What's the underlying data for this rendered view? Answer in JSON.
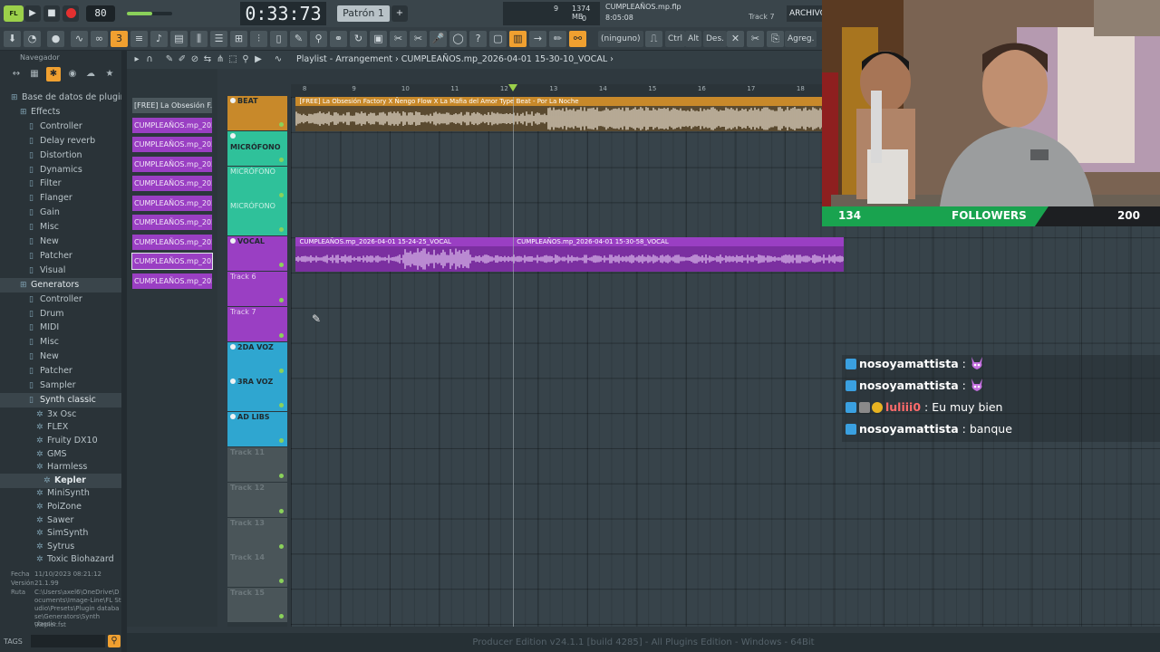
{
  "colors": {
    "accent": "#f0a030",
    "beat": "#c8892a",
    "microfono": "#2fc19a",
    "vocal": "#9a3fc3",
    "voz": "#2fa6d0",
    "followers_bar": "#19a34f"
  },
  "transport": {
    "logo": "FL",
    "play_icon": "play-icon",
    "stop_icon": "stop-icon",
    "record_icon": "record-icon",
    "tempo": "80.000",
    "tempo_display": "80",
    "time": "0:33:73",
    "time_prefix": "M:S:CS",
    "pattern": "Patrón 1",
    "volume_level": 0.56
  },
  "hint_panel": {
    "cpu": "9",
    "memory": "1374 MB",
    "polyphony": "0"
  },
  "file": {
    "title": "CUMPLEAÑOS.mp.flp",
    "time": "8:05:08",
    "current_track": "Track 7",
    "archive_label": "ARCHIVO"
  },
  "toolbar2": {
    "preset": "(ninguno)",
    "ctrl": "Ctrl",
    "alt": "Alt",
    "des": "Des.",
    "agreg": "Agreg."
  },
  "browser": {
    "header": "Navegador",
    "root": "Base de datos de plugins",
    "effects_label": "Effects",
    "effects": [
      "Controller",
      "Delay reverb",
      "Distortion",
      "Dynamics",
      "Filter",
      "Flanger",
      "Gain",
      "Misc",
      "New",
      "Patcher",
      "Visual"
    ],
    "generators_label": "Generators",
    "generators": [
      "Controller",
      "Drum",
      "MIDI",
      "Misc",
      "New",
      "Patcher",
      "Sampler",
      "Synth classic"
    ],
    "synths": [
      "3x Osc",
      "FLEX",
      "Fruity DX10",
      "GMS",
      "Harmless",
      "Kepler",
      "MiniSynth",
      "PoiZone",
      "Sawer",
      "SimSynth",
      "Sytrus",
      "Toxic Biohazard"
    ],
    "selected_synth": "Kepler",
    "info": {
      "fecha_label": "Fecha",
      "fecha": "11/10/2023 08:21:12",
      "version_label": "Versión",
      "version": "21.1.99",
      "ruta_label": "Ruta",
      "ruta_lines": [
        "C:\\Users\\axel6\\OneDrive\\D",
        "ocuments\\Image-Line\\FL St",
        "udio\\Presets\\Plugin databa",
        "se\\Generators\\Synth classic",
        "\\Kepler.fst"
      ]
    },
    "tags": "TAGS"
  },
  "playlist": {
    "title_prefix": "Playlist - Arrangement",
    "title_clip": "CUMPLEAÑOS.mp_2026-04-01 15-30-10_VOCAL",
    "clip_list": [
      {
        "label": "[FREE] La Obsesión F...",
        "style": "gray"
      },
      {
        "label": "CUMPLEAÑOS.mp_2026-0...",
        "style": "purple"
      },
      {
        "label": "CUMPLEAÑOS.mp_2026-0...",
        "style": "purple"
      },
      {
        "label": "CUMPLEAÑOS.mp_2026-0...",
        "style": "purple"
      },
      {
        "label": "CUMPLEAÑOS.mp_2026-0...",
        "style": "purple"
      },
      {
        "label": "CUMPLEAÑOS.mp_2026-0...",
        "style": "purple"
      },
      {
        "label": "CUMPLEAÑOS.mp_2026-0...",
        "style": "purple"
      },
      {
        "label": "CUMPLEAÑOS.mp_2026-0...",
        "style": "purple"
      },
      {
        "label": "CUMPLEAÑOS.mp_2026-0...",
        "style": "purple-sel"
      },
      {
        "label": "CUMPLEAÑOS.mp_2026-0...",
        "style": "purple"
      }
    ],
    "bar_numbers": [
      "8",
      "9",
      "10",
      "11",
      "12",
      "13",
      "14",
      "15",
      "16",
      "17",
      "18"
    ],
    "playhead_bar": 12.3,
    "tracks": [
      {
        "name": "BEAT",
        "color": "beat",
        "dot": true
      },
      {
        "name": "MICRÓFONO",
        "color": "microfono",
        "dot": true
      },
      {
        "name": "MICRÓFONO",
        "color": "microfono",
        "dot": false
      },
      {
        "name": "MICRÓFONO",
        "color": "microfono",
        "dot": false
      },
      {
        "name": "VOCAL",
        "color": "vocal",
        "dot": true
      },
      {
        "name": "Track 6",
        "color": "vocal",
        "dot": false
      },
      {
        "name": "Track 7",
        "color": "vocal",
        "dot": false
      },
      {
        "name": "2DA VOZ",
        "color": "voz",
        "dot": true
      },
      {
        "name": "3RA VOZ",
        "color": "voz",
        "dot": true
      },
      {
        "name": "AD LIBS",
        "color": "voz",
        "dot": true
      },
      {
        "name": "Track 11",
        "color": "gray",
        "dot": false
      },
      {
        "name": "Track 12",
        "color": "gray",
        "dot": false
      },
      {
        "name": "Track 13",
        "color": "gray",
        "dot": false
      },
      {
        "name": "Track 14",
        "color": "gray",
        "dot": false
      },
      {
        "name": "Track 15",
        "color": "gray",
        "dot": false
      }
    ],
    "clips": [
      {
        "track": 0,
        "start_bar": 7.9,
        "end_bar": 19.0,
        "color": "beat",
        "title": "[FREE] La Obsesión Factory X Ñengo Flow X La Mafia del Amor Type Beat - Por La Noche",
        "waveform_split_bar": 13.0
      },
      {
        "track": 4,
        "start_bar": 7.9,
        "end_bar": 12.3,
        "color": "vocal",
        "title": "CUMPLEAÑOS.mp_2026-04-01 15-24-25_VOCAL"
      },
      {
        "track": 4,
        "start_bar": 12.3,
        "end_bar": 19.0,
        "color": "vocal",
        "title": "CUMPLEAÑOS.mp_2026-04-01 15-30-58_VOCAL"
      }
    ]
  },
  "status_bar": "Producer Edition v24.1.1 [build 4285] - All Plugins Edition - Windows - 64Bit",
  "followers": {
    "current": "134",
    "label": "FOLLOWERS",
    "goal": "200",
    "progress": 0.67
  },
  "chat": [
    {
      "user": "nosoyamattista",
      "text": ":",
      "user_color": "#ffffff",
      "emote": true
    },
    {
      "user": "nosoyamattista",
      "text": ":",
      "user_color": "#ffffff",
      "emote": true
    },
    {
      "user": "luliii0",
      "text": ": Eu muy bien",
      "user_color": "#ff6b6b",
      "emote": false,
      "extra_badges": true
    },
    {
      "user": "nosoyamattista",
      "text": ": banque",
      "user_color": "#ffffff",
      "emote": false
    }
  ]
}
